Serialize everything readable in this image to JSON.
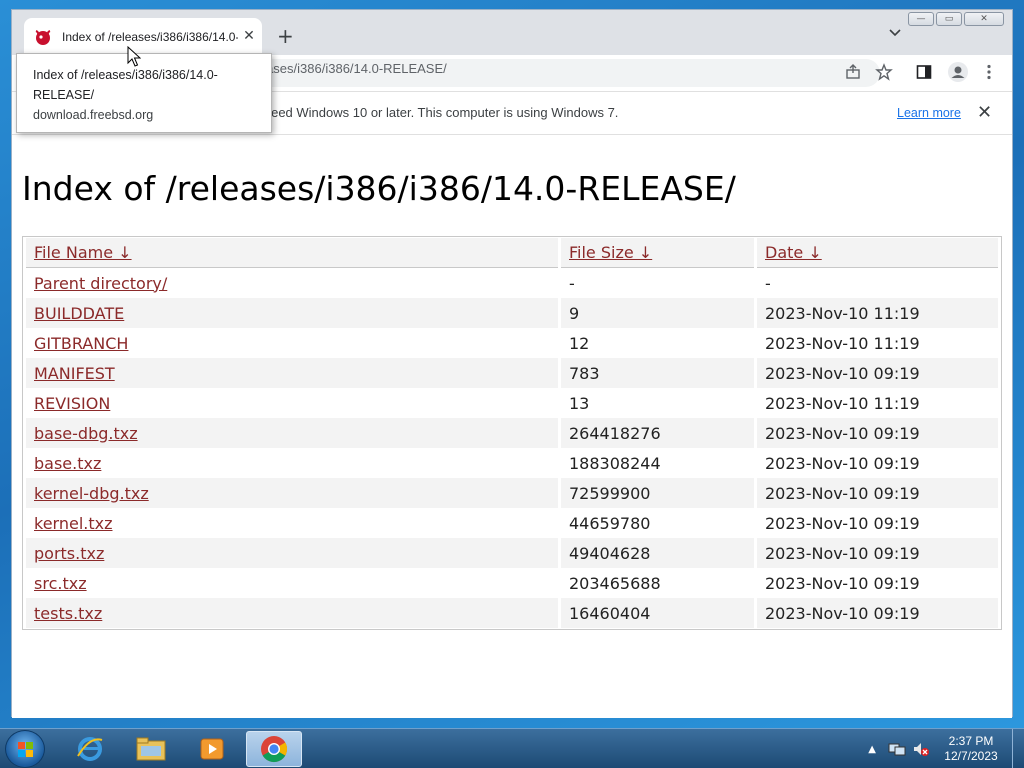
{
  "browser": {
    "tab": {
      "title": "Index of /releases/i386/i386/14.0-RELEASE/"
    },
    "omnibox": {
      "url_visible": "org/releases/i386/i386/14.0-RELEASE/"
    },
    "infobar": {
      "message": "'ll need Windows 10 or later. This computer is using Windows 7.",
      "learn_more": "Learn more"
    },
    "tooltip": {
      "title": "Index of /releases/i386/i386/14.0-RELEASE/",
      "host": "download.freebsd.org"
    }
  },
  "page": {
    "heading": "Index of /releases/i386/i386/14.0-RELEASE/",
    "columns": [
      "File Name  ↓",
      "File Size  ↓",
      "Date  ↓"
    ],
    "rows": [
      {
        "name": "Parent directory/",
        "size": "-",
        "date": "-"
      },
      {
        "name": "BUILDDATE",
        "size": "9",
        "date": "2023-Nov-10 11:19"
      },
      {
        "name": "GITBRANCH",
        "size": "12",
        "date": "2023-Nov-10 11:19"
      },
      {
        "name": "MANIFEST",
        "size": "783",
        "date": "2023-Nov-10 09:19"
      },
      {
        "name": "REVISION",
        "size": "13",
        "date": "2023-Nov-10 11:19"
      },
      {
        "name": "base-dbg.txz",
        "size": "264418276",
        "date": "2023-Nov-10 09:19"
      },
      {
        "name": "base.txz",
        "size": "188308244",
        "date": "2023-Nov-10 09:19"
      },
      {
        "name": "kernel-dbg.txz",
        "size": "72599900",
        "date": "2023-Nov-10 09:19"
      },
      {
        "name": "kernel.txz",
        "size": "44659780",
        "date": "2023-Nov-10 09:19"
      },
      {
        "name": "ports.txz",
        "size": "49404628",
        "date": "2023-Nov-10 09:19"
      },
      {
        "name": "src.txz",
        "size": "203465688",
        "date": "2023-Nov-10 09:19"
      },
      {
        "name": "tests.txz",
        "size": "16460404",
        "date": "2023-Nov-10 09:19"
      }
    ]
  },
  "taskbar": {
    "time": "2:37 PM",
    "date": "12/7/2023",
    "apps": [
      "internet-explorer",
      "windows-explorer",
      "media-player",
      "google-chrome"
    ]
  },
  "colors": {
    "link": "#8b2a2a",
    "learn_more": "#1a73e8",
    "row_alt": "#f3f3f3"
  }
}
